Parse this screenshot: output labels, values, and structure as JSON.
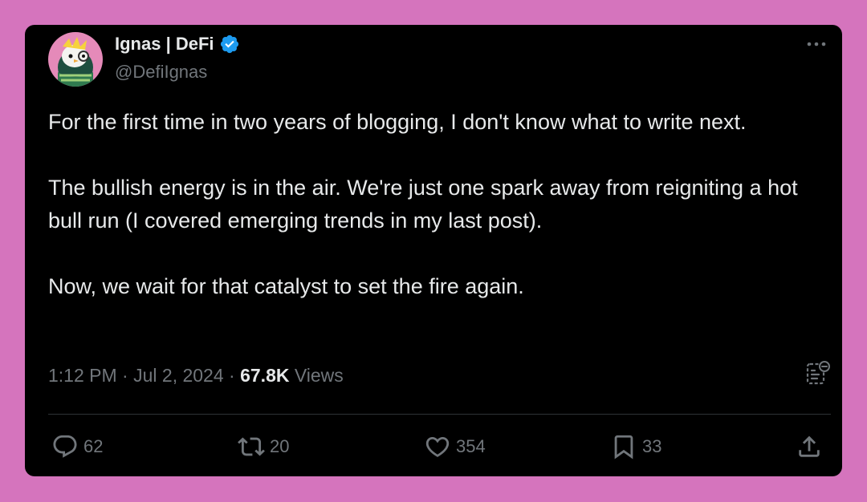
{
  "author": {
    "display_name": "Ignas | DeFi",
    "handle": "@DefiIgnas",
    "verified_icon": "verified-badge-icon",
    "avatar_icon": "penguin-avatar"
  },
  "tweet": {
    "paragraphs": [
      "For the first time in two years of blogging, I don't know what to write next.",
      "The bullish energy is in the air. We're just one spark away from reigniting a hot bull run (I covered emerging trends in my last post).",
      "Now, we wait for that catalyst to set the fire again."
    ]
  },
  "meta": {
    "time": "1:12 PM",
    "separator": "·",
    "date": "Jul 2, 2024",
    "views_count": "67.8K",
    "views_label": "Views"
  },
  "actions": {
    "replies": "62",
    "reposts": "20",
    "likes": "354",
    "bookmarks": "33"
  },
  "colors": {
    "background": "#d574bd",
    "card": "#000000",
    "text": "#e7e9ea",
    "muted": "#71767b",
    "verified": "#1d9bf0"
  }
}
